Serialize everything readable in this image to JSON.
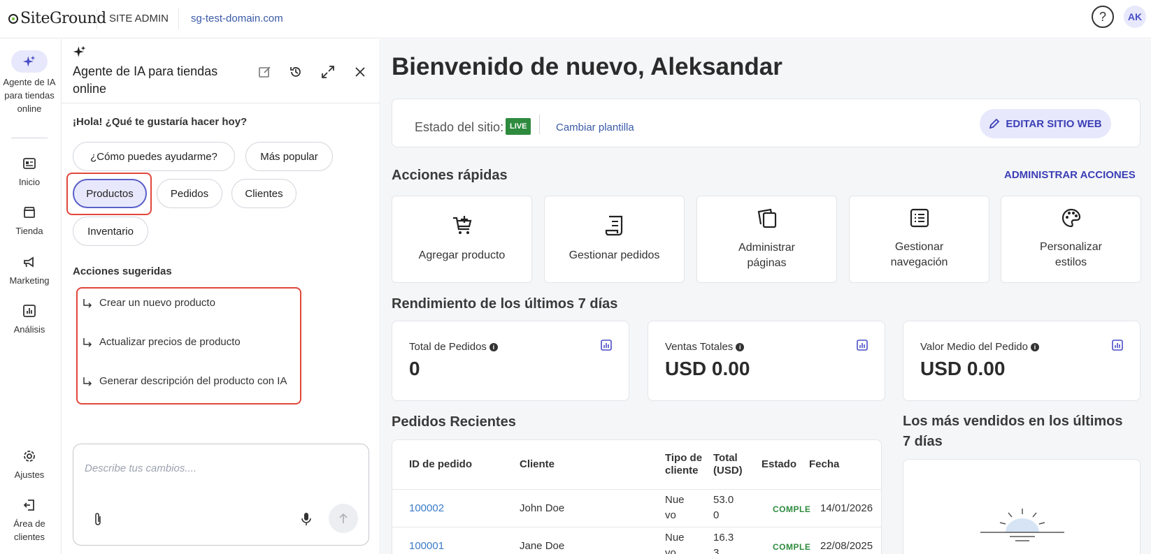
{
  "topbar": {
    "logo_text": "SiteGround",
    "section": "SITE ADMIN",
    "domain": "sg-test-domain.com",
    "help_label": "?",
    "avatar_initials": "AK"
  },
  "leftnav": {
    "items": [
      {
        "label": "Agente de IA para tiendas online",
        "icon": "sparkle-icon"
      },
      {
        "label": "Inicio",
        "icon": "dashboard-icon"
      },
      {
        "label": "Tienda",
        "icon": "store-icon"
      },
      {
        "label": "Marketing",
        "icon": "megaphone-icon"
      },
      {
        "label": "Análisis",
        "icon": "analytics-icon"
      },
      {
        "label": "Ajustes",
        "icon": "gear-icon"
      },
      {
        "label": "Área de clientes",
        "icon": "exit-icon"
      }
    ]
  },
  "ai_panel": {
    "title": "Agente de IA para tiendas online",
    "greeting": "¡Hola! ¿Qué te gustaría hacer hoy?",
    "chips": [
      "¿Cómo puedes ayudarme?",
      "Más popular",
      "Productos",
      "Pedidos",
      "Clientes",
      "Inventario"
    ],
    "active_chip": "Productos",
    "suggested_title": "Acciones sugeridas",
    "suggestions": [
      "Crear un nuevo producto",
      "Actualizar precios de producto",
      "Generar descripción del producto con IA"
    ],
    "composer_placeholder": "Describe tus cambios...."
  },
  "main": {
    "welcome": "Bienvenido de nuevo, Aleksandar",
    "status": {
      "label": "Estado del sitio:",
      "badge": "LIVE",
      "change_template": "Cambiar plantilla",
      "edit_button": "EDITAR SITIO WEB"
    },
    "quick_actions": {
      "title": "Acciones rápidas",
      "manage": "ADMINISTRAR ACCIONES",
      "items": [
        {
          "label": "Agregar producto",
          "icon": "add-cart-icon"
        },
        {
          "label": "Gestionar pedidos",
          "icon": "receipt-icon"
        },
        {
          "label": "Administrar páginas",
          "icon": "pages-icon"
        },
        {
          "label": "Gestionar navegación",
          "icon": "list-icon"
        },
        {
          "label": "Personalizar estilos",
          "icon": "palette-icon"
        }
      ]
    },
    "performance": {
      "title": "Rendimiento de los últimos 7 días",
      "stats": [
        {
          "label": "Total de Pedidos",
          "value": "0"
        },
        {
          "label": "Ventas Totales",
          "value": "USD 0.00"
        },
        {
          "label": "Valor Medio del Pedido",
          "value": "USD 0.00"
        }
      ]
    },
    "recent_orders": {
      "title": "Pedidos Recientes",
      "columns": [
        "ID de pedido",
        "Cliente",
        "Tipo de cliente",
        "Total (USD)",
        "Estado",
        "Fecha"
      ],
      "rows": [
        {
          "id": "100002",
          "client": "John Doe",
          "type": "Nue vo",
          "total": "53.0 0",
          "status": "COMPLE",
          "date": "14/01/2026"
        },
        {
          "id": "100001",
          "client": "Jane Doe",
          "type": "Nue vo",
          "total": "16.3 3",
          "status": "COMPLE",
          "date": "22/08/2025"
        }
      ]
    },
    "best_sellers": {
      "title": "Los más vendidos en los últimos 7 días"
    }
  },
  "colors": {
    "accent": "#3b3fb6",
    "accent_bg": "#e7e8fb",
    "live_green": "#2e8b3e",
    "highlight_red": "#e0473a",
    "link_blue": "#3a7bc8"
  }
}
